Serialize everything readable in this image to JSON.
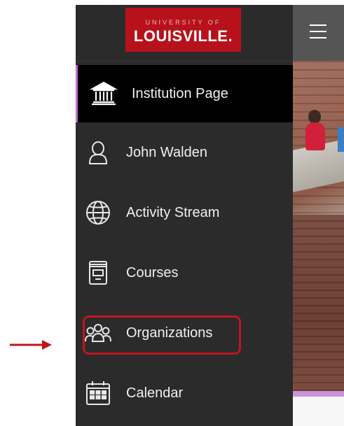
{
  "logo": {
    "top_text": "UNIVERSITY OF",
    "main_text": "LOUISVILLE."
  },
  "nav": {
    "items": [
      {
        "label": "Institution Page",
        "icon": "institution-icon",
        "active": true
      },
      {
        "label": "John Walden",
        "icon": "user-icon",
        "active": false
      },
      {
        "label": "Activity Stream",
        "icon": "globe-icon",
        "active": false
      },
      {
        "label": "Courses",
        "icon": "courses-icon",
        "active": false
      },
      {
        "label": "Organizations",
        "icon": "organizations-icon",
        "active": false,
        "highlighted": true
      },
      {
        "label": "Calendar",
        "icon": "calendar-icon",
        "active": false
      }
    ]
  },
  "colors": {
    "sidebar_bg": "#2b2b2b",
    "active_bg": "#000000",
    "active_accent": "#c06bd4",
    "logo_bg": "#b7121b",
    "annotation_red": "#c0161f"
  }
}
